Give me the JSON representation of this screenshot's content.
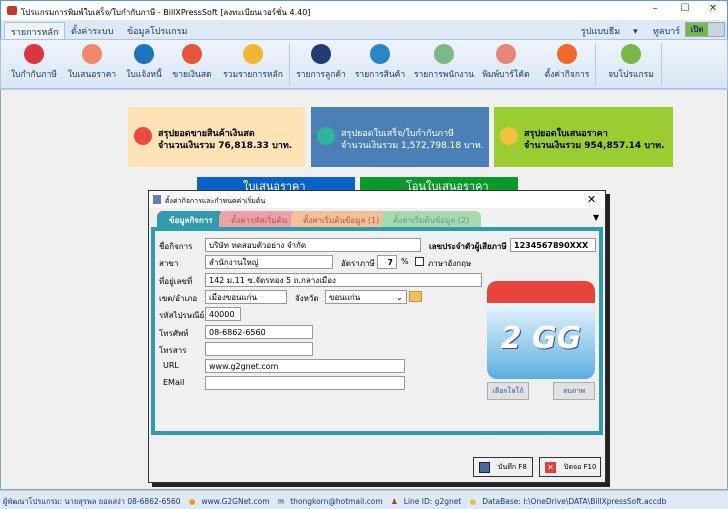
{
  "window": {
    "title": "โปรแกรมการพิมพ์ใบเสร็จ/ใบกำกับภาษี - BillXPressSoft [ลงทะเบียนเวอร์ชั่น 4.40]",
    "minimize": "–",
    "maximize": "☐",
    "close": "✕"
  },
  "menu": {
    "tabs": [
      "รายการหลัก",
      "ตั้งค่าระบบ",
      "ข้อมูลโปรแกรม"
    ],
    "theme_label": "รูปแบบธีม",
    "toolbar_label": "ทูลบาร์",
    "toggle": "เปิด"
  },
  "toolbar": [
    {
      "label": "ใบกำกับภาษี",
      "color": "#d9363e"
    },
    {
      "label": "ใบเสนอราคา",
      "color": "#f08a6a"
    },
    {
      "label": "ใบแจ้งหนี้",
      "color": "#1e73be"
    },
    {
      "label": "ขายเงินสด",
      "color": "#e8553a"
    },
    {
      "label": "รวมรายการหลัก",
      "color": "#f2b632"
    },
    {
      "label": "รายการลูกค้า",
      "color": "#1f3f73"
    },
    {
      "label": "รายการสินค้า",
      "color": "#2a86c8"
    },
    {
      "label": "รายการพนักงาน",
      "color": "#7cb98a"
    },
    {
      "label": "พิมพ์บาร์โค้ด",
      "color": "#e8857a"
    },
    {
      "label": "ตั้งค่ากิจการ",
      "color": "#f26a2a"
    },
    {
      "label": "จบโปรแกรม",
      "color": "#7ab648"
    }
  ],
  "cards": [
    {
      "title": "สรุปยอดขายสินค้าเงินสด",
      "amount": "จำนวนเงินรวม 76,818.33 บาท.",
      "bg": "#fde3b5",
      "fg": "#222"
    },
    {
      "title": "สรุปยอดใบเสร็จ/ใบกำกับภาษี",
      "amount": "จำนวนเงินรวม 1,572,798.18 บาท.",
      "bg": "#4a80b5",
      "fg": "#fff"
    },
    {
      "title": "สรุปยอดใบเสนอราคา",
      "amount": "จำนวนเงินรวม 954,857.14 บาท.",
      "bg": "#9acd32",
      "fg": "#222"
    }
  ],
  "quick_buttons": [
    "ใบเสนอราคา",
    "โอนใบเสนอราคา"
  ],
  "dialog": {
    "title": "ตั้งค่ากิจการและกำหนดค่าเริ่มต้น",
    "close": "✕",
    "tabs": [
      "ข้อมูลกิจการ",
      "ตั้งค่ารหัสเริ่มต้น",
      "ตั้งค่าเริ่มต้นข้อมูล (1)",
      "ตั้งค่าเริ่มต้นข้อมูล (2)"
    ],
    "fields": {
      "company_label": "ชื่อกิจการ",
      "company": "บริษัท ทดสอบตัวอย่าง จำกัด",
      "taxid_label": "เลขประจำตัวผู้เสียภาษี",
      "taxid": "1234567890XXX",
      "branch_label": "สาขา",
      "branch": "สำนักงานใหญ่",
      "vat_label": "อัตราภาษี",
      "vat": "7",
      "vat_unit": "%",
      "english_label": "ภาษาอังกฤษ",
      "address_label": "ที่อยู่เลขที่",
      "address": "142 ม.11 ซ.จัดรทอง 5 ถ.กลางเมือง",
      "district_label": "เขต/อำเภอ",
      "district": "เมืองขอนแก่น",
      "province_label": "จังหวัด",
      "province": "ขอนแก่น",
      "zip_label": "รหัสไปรษณีย์",
      "zip": "40000",
      "phone_label": "โทรศัพท์",
      "phone": "08-6862-6560",
      "fax_label": "โทรสาร",
      "fax": "",
      "url_label": "URL",
      "url": "www.g2gnet.com",
      "email_label": "EMail",
      "email": ""
    },
    "logo_text": "2 GG",
    "choose_logo": "เลือกโลโก้",
    "delete_image": "ลบภาพ",
    "save": "บันทึก F8",
    "close_btn": "ปิดจอ F10"
  },
  "status": {
    "developer": "ผู้พัฒนาโปรแกรม: นายสุรพล ยอดสง่า 08-6862-6560",
    "website": "www.G2GNet.com",
    "email": "thongkorn@hotmail.com",
    "line": "Line ID: g2gnet",
    "database": "DataBase: I:\\OneDrive\\DATA\\BillXpressSoft.accdb"
  }
}
